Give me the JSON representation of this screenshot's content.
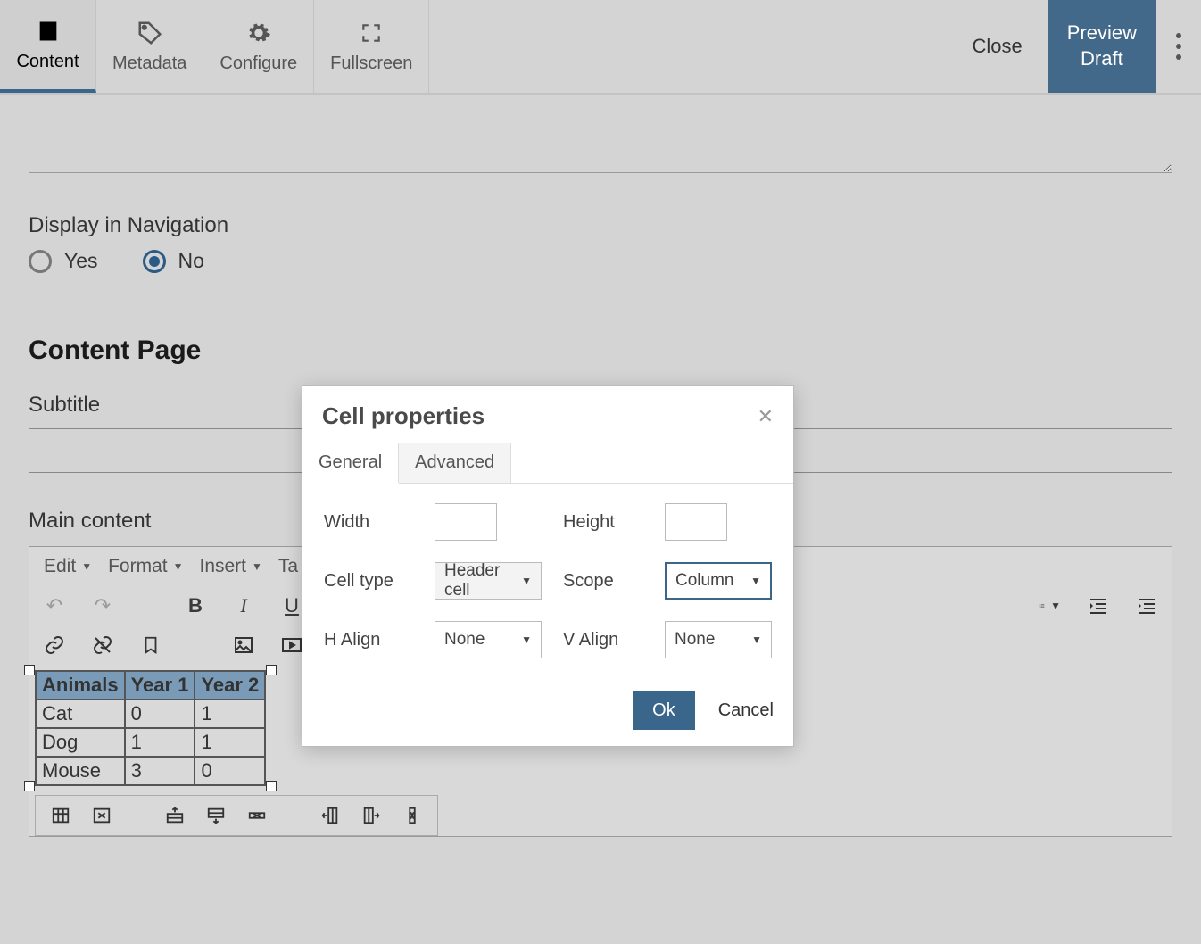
{
  "toolbar": {
    "tabs": [
      {
        "label": "Content"
      },
      {
        "label": "Metadata"
      },
      {
        "label": "Configure"
      },
      {
        "label": "Fullscreen"
      }
    ],
    "close_label": "Close",
    "preview_label": "Preview\nDraft"
  },
  "nav_display": {
    "label": "Display in Navigation",
    "yes": "Yes",
    "no": "No",
    "selected": "No"
  },
  "content_page": {
    "heading": "Content Page",
    "subtitle_label": "Subtitle",
    "subtitle_value": "",
    "main_content_label": "Main content"
  },
  "editor": {
    "menus": {
      "edit": "Edit",
      "format": "Format",
      "insert": "Insert",
      "table_partial": "Ta"
    },
    "table": {
      "headers": [
        "Animals",
        "Year 1",
        "Year 2"
      ],
      "rows": [
        [
          "Cat",
          "0",
          "1"
        ],
        [
          "Dog",
          "1",
          "1"
        ],
        [
          "Mouse",
          "3",
          "0"
        ]
      ]
    }
  },
  "modal": {
    "title": "Cell properties",
    "tabs": {
      "general": "General",
      "advanced": "Advanced"
    },
    "fields": {
      "width_label": "Width",
      "width_value": "",
      "height_label": "Height",
      "height_value": "",
      "cell_type_label": "Cell type",
      "cell_type_value": "Header cell",
      "scope_label": "Scope",
      "scope_value": "Column",
      "h_align_label": "H Align",
      "h_align_value": "None",
      "v_align_label": "V Align",
      "v_align_value": "None"
    },
    "ok": "Ok",
    "cancel": "Cancel"
  }
}
